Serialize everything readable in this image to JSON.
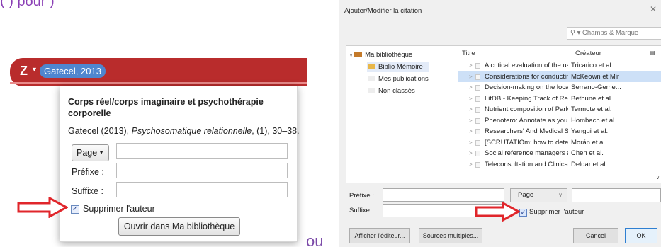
{
  "caption_fragment": "(                          ) pour                                  )",
  "separator_word": "ou",
  "word_plugin": {
    "logo": "Z",
    "citation_bubble": "Gatecel, 2013",
    "popup": {
      "title": "Corps réel/corps imaginaire et psychothérapie corporelle",
      "source_prefix": "Gatecel (2013), ",
      "source_journal": "Psychosomatique relationnelle",
      "source_suffix": ", (1), 30–38.",
      "locator_type": "Page",
      "locator_value": "",
      "prefix_label": "Préfixe :",
      "prefix_value": "",
      "suffix_label": "Suffixe :",
      "suffix_value": "",
      "suppress_author_label": "Supprimer l'auteur",
      "suppress_author_checked": true,
      "open_library_button": "Ouvrir dans Ma bibliothèque"
    }
  },
  "dialog": {
    "title": "Ajouter/Modifier la citation",
    "search_placeholder": "▾ Champs & Marque",
    "library": {
      "root": "Ma bibliothèque",
      "items": [
        "Biblio Mémoire",
        "Mes publications",
        "Non classés"
      ],
      "selected": "Biblio Mémoire"
    },
    "columns": {
      "title": "Titre",
      "creator": "Créateur"
    },
    "rows": [
      {
        "title": "A critical evaluation of the us...",
        "creator": "Tricarico et al."
      },
      {
        "title": "Considerations for conductin...",
        "creator": "McKeown et Mir"
      },
      {
        "title": "Decision-making on the loca...",
        "creator": "Serrano-Geme..."
      },
      {
        "title": "LitDB - Keeping Track of Res...",
        "creator": "Bethune et al."
      },
      {
        "title": "Nutrient composition of Park...",
        "creator": "Termote et al."
      },
      {
        "title": "Phenotero: Annotate as you ...",
        "creator": "Hombach et al."
      },
      {
        "title": "Researchers' And Medical St...",
        "creator": "Yangui et al."
      },
      {
        "title": "[SCRUTATIOm: how to detec...",
        "creator": "Morán et al."
      },
      {
        "title": "Social reference managers an...",
        "creator": "Chen et al."
      },
      {
        "title": "Teleconsultation and Clinical ...",
        "creator": "Deldar et al."
      }
    ],
    "selected_row": 1,
    "prefix_label": "Préfixe :",
    "suffix_label": "Suffixe :",
    "prefix_value": "",
    "suffix_value": "",
    "locator_type": "Page",
    "locator_value": "",
    "suppress_author_label": "Supprimer l'auteur",
    "suppress_author_checked": true,
    "buttons": {
      "editor": "Afficher l'éditeur...",
      "multiple_sources": "Sources multiples...",
      "cancel": "Cancel",
      "ok": "OK"
    }
  },
  "colors": {
    "zotero_red": "#b92c2c",
    "bubble_blue": "#4f86cf",
    "arrow_red": "#e0262b",
    "caption_purple": "#8a3fb5",
    "folder_yellow": "#e8b74a",
    "selection_blue": "#cde0f7"
  },
  "icons": [
    "zotero-logo-icon",
    "folder-icon",
    "document-icon",
    "red-arrow-icon",
    "checkbox-icon",
    "chevron-down-icon",
    "search-icon"
  ]
}
